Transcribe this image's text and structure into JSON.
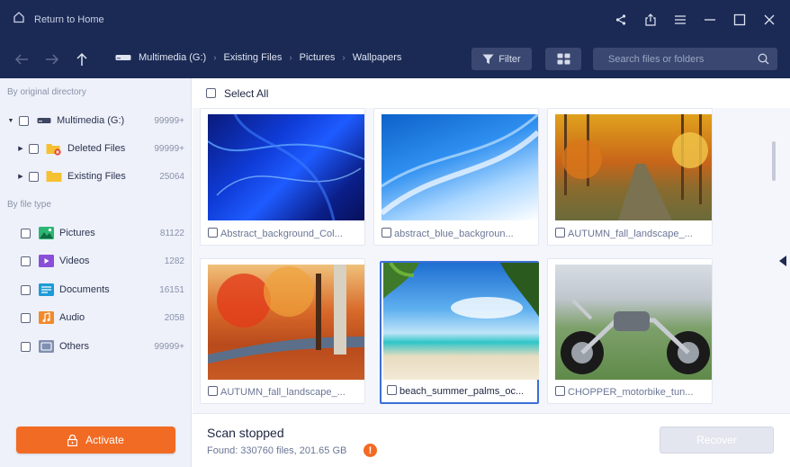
{
  "titlebar": {
    "home_label": "Return to Home"
  },
  "toolbar": {
    "breadcrumb": [
      "Multimedia (G:)",
      "Existing Files",
      "Pictures",
      "Wallpapers"
    ],
    "filter_label": "Filter",
    "search_placeholder": "Search files or folders"
  },
  "sidebar": {
    "by_directory_heading": "By original directory",
    "tree": [
      {
        "label": "Multimedia (G:)",
        "count": "99999+"
      },
      {
        "label": "Deleted Files",
        "count": "99999+"
      },
      {
        "label": "Existing Files",
        "count": "25064"
      }
    ],
    "by_type_heading": "By file type",
    "types": [
      {
        "label": "Pictures",
        "count": "81122"
      },
      {
        "label": "Videos",
        "count": "1282"
      },
      {
        "label": "Documents",
        "count": "16151"
      },
      {
        "label": "Audio",
        "count": "2058"
      },
      {
        "label": "Others",
        "count": "99999+"
      }
    ],
    "activate_label": "Activate"
  },
  "main": {
    "select_all_label": "Select All",
    "files": [
      {
        "name": "Abstract_background_Col..."
      },
      {
        "name": "abstract_blue_backgroun..."
      },
      {
        "name": "AUTUMN_fall_landscape_..."
      },
      {
        "name": "AUTUMN_fall_landscape_..."
      },
      {
        "name": "beach_summer_palms_oc..."
      },
      {
        "name": "CHOPPER_motorbike_tun..."
      }
    ]
  },
  "status": {
    "title": "Scan stopped",
    "found": "Found: 330760 files, 201.65 GB",
    "warning_symbol": "!",
    "recover_label": "Recover"
  },
  "colors": {
    "brand_dark": "#1b2a55",
    "accent_orange": "#f26b24",
    "selection_blue": "#3a6fd8"
  }
}
